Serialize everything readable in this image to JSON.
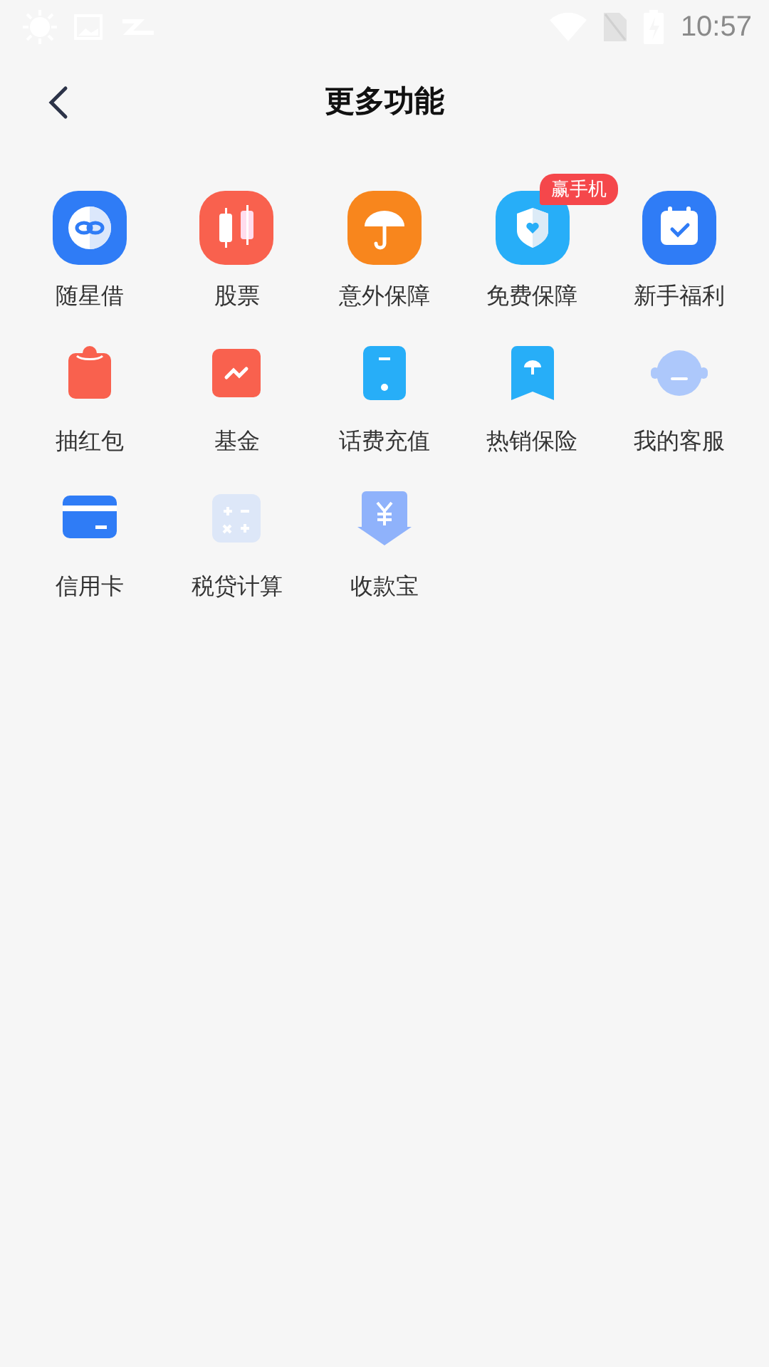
{
  "status_bar": {
    "time": "10:57"
  },
  "header": {
    "title": "更多功能"
  },
  "features": [
    {
      "label": "随星借",
      "kind": "loan"
    },
    {
      "label": "股票",
      "kind": "stock"
    },
    {
      "label": "意外保障",
      "kind": "umbrella"
    },
    {
      "label": "免费保障",
      "kind": "shield",
      "badge": "赢手机"
    },
    {
      "label": "新手福利",
      "kind": "calendar"
    },
    {
      "label": "抽红包",
      "kind": "redpacket"
    },
    {
      "label": "基金",
      "kind": "fund"
    },
    {
      "label": "话费充值",
      "kind": "phone"
    },
    {
      "label": "热销保险",
      "kind": "bookmark"
    },
    {
      "label": "我的客服",
      "kind": "service"
    },
    {
      "label": "信用卡",
      "kind": "card"
    },
    {
      "label": "税贷计算",
      "kind": "calculator"
    },
    {
      "label": "收款宝",
      "kind": "receive"
    }
  ]
}
